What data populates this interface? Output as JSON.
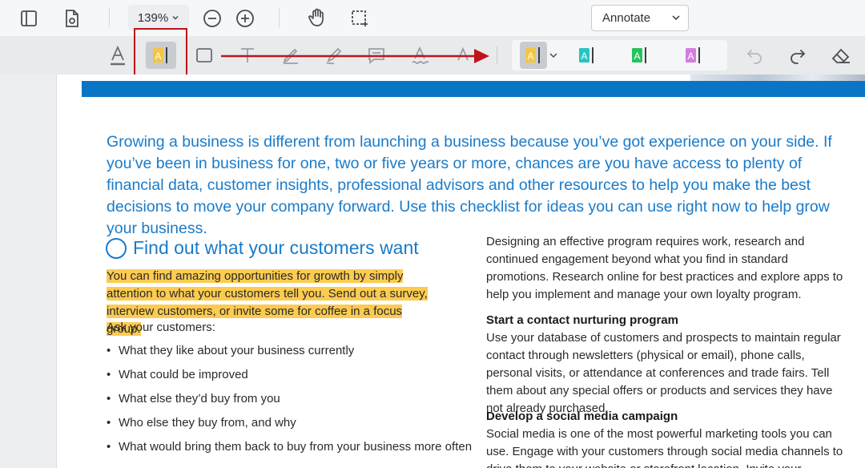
{
  "toolbar": {
    "zoom": "139%",
    "mode_select": "Annotate"
  },
  "annotation_tools": {
    "highlight_colors": [
      "#f5c542",
      "#27c4c4",
      "#23c45c",
      "#d67be3"
    ],
    "active_tool": "highlight-text",
    "callout_color": "#c0141b"
  },
  "document": {
    "intro": "Growing a business is different from launching a business because you’ve got experience on your side. If you’ve been in business for one, two or five years or more, chances are you have access to plenty of financial data, customer insights, professional advisors and other resources to help you make the best decisions to move your company forward. Use this checklist for ideas you can use right now to help grow your business.",
    "section_title": "Find out what your customers want",
    "highlighted_lines": [
      "You can find amazing opportunities for growth by simply paying",
      "attention to what your customers tell you. Send out a survey,",
      "interview customers, or invite some for coffee in a focus group."
    ],
    "ask_label": "Ask your customers:",
    "bullets": [
      "What they like about your business currently",
      "What could be improved",
      "What else they’d buy from you",
      "Who else they buy from, and why",
      "What would bring them back to buy from your business more often"
    ],
    "right_intro": "Designing an effective program requires work, research and continued engagement beyond what you find in standard promotions. Research online for best practices and explore apps to help you implement and manage your own loyalty program.",
    "contact_head": "Start a contact nurturing program",
    "contact_body": "Use your database of customers and prospects to maintain regular contact through newsletters (physical or email), phone calls, personal visits, or attendance at conferences and trade fairs. Tell them about any special offers or products and services they have not already purchased.",
    "social_head": "Develop a social media campaign",
    "social_body": "Social media is one of the most powerful marketing tools you can use. Engage with your customers through social media channels to drive them to your website or storefront location. Invite your"
  }
}
